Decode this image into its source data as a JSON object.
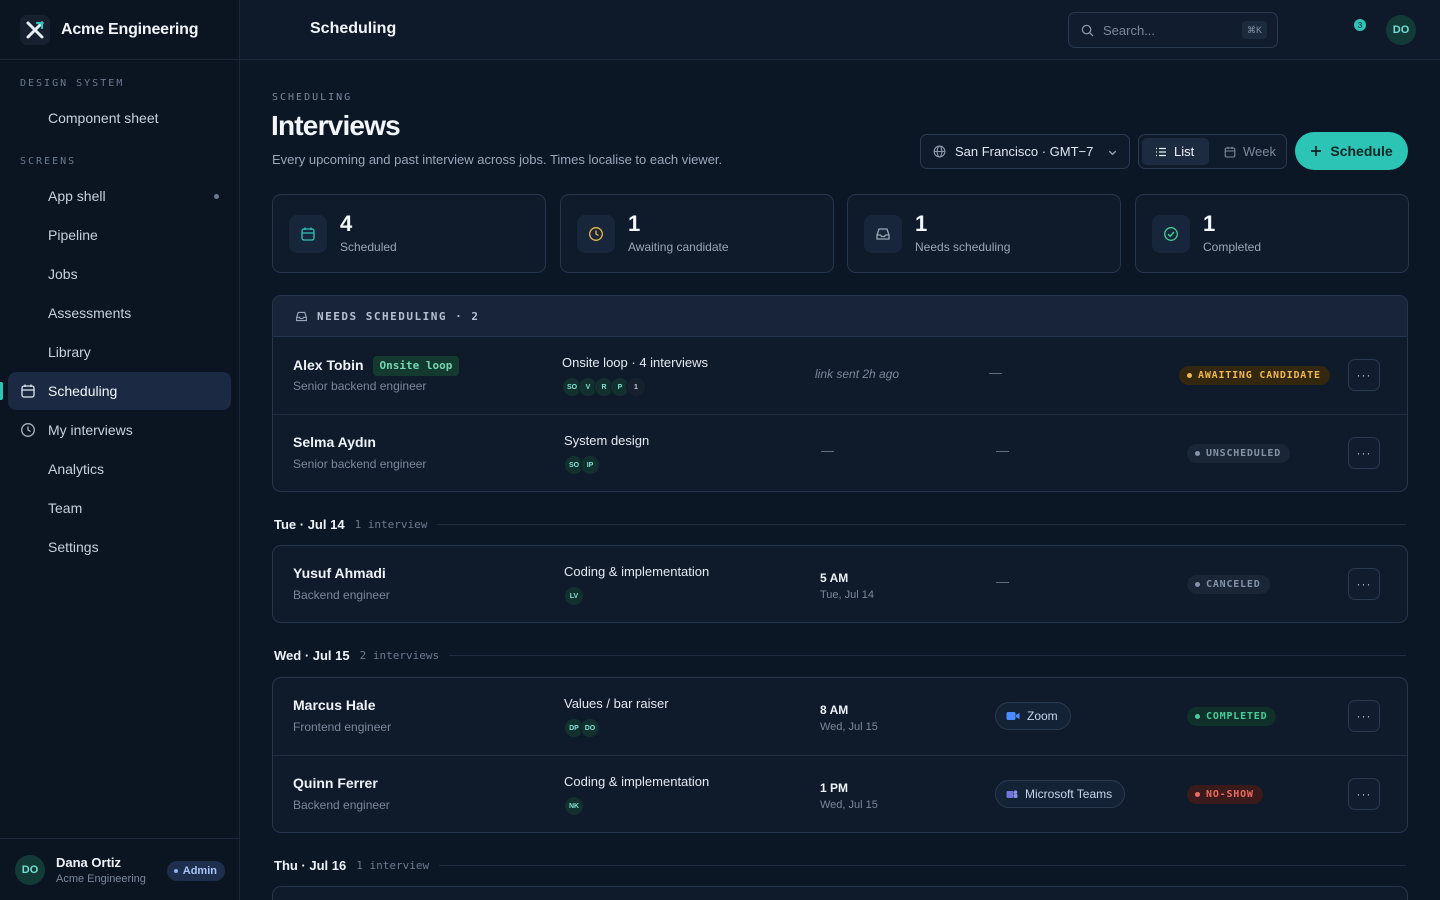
{
  "app": {
    "brand": "Acme Engineering"
  },
  "sidebar": {
    "section_design": "DESIGN SYSTEM",
    "section_screens": "SCREENS",
    "design_items": [
      {
        "label": "Component sheet"
      }
    ],
    "items": [
      {
        "label": "App shell"
      },
      {
        "label": "Pipeline"
      },
      {
        "label": "Jobs"
      },
      {
        "label": "Assessments"
      },
      {
        "label": "Library"
      },
      {
        "label": "Scheduling",
        "active": true
      },
      {
        "label": "My interviews"
      },
      {
        "label": "Analytics"
      },
      {
        "label": "Team"
      },
      {
        "label": "Settings"
      }
    ],
    "user": {
      "initials": "DO",
      "name": "Dana Ortiz",
      "org": "Acme Engineering",
      "role": "Admin"
    }
  },
  "topbar": {
    "title": "Scheduling",
    "search_placeholder": "Search...",
    "shortcut": "⌘K",
    "notification_count": "3",
    "avatar_initials": "DO"
  },
  "page": {
    "eyebrow": "SCHEDULING",
    "title": "Interviews",
    "subtitle": "Every upcoming and past interview across jobs. Times localise to each viewer.",
    "timezone": "San Francisco · GMT−7",
    "view_list": "List",
    "view_week": "Week",
    "schedule_label": "Schedule"
  },
  "stats": [
    {
      "value": "4",
      "label": "Scheduled",
      "icon": "calendar-icon",
      "color": "#2ec4b6"
    },
    {
      "value": "1",
      "label": "Awaiting candidate",
      "icon": "clock-icon",
      "color": "#f2b94a"
    },
    {
      "value": "1",
      "label": "Needs scheduling",
      "icon": "inbox-icon",
      "color": "#9aa7b8"
    },
    {
      "value": "1",
      "label": "Completed",
      "icon": "check-circle-icon",
      "color": "#45cf9a"
    }
  ],
  "needs_scheduling": {
    "header": "NEEDS SCHEDULING · 2",
    "rows": [
      {
        "name": "Alex Tobin",
        "tag": "Onsite loop",
        "role": "Senior backend engineer",
        "interview": "Onsite loop · 4 interviews",
        "chips": [
          "SO",
          "V",
          "R",
          "P",
          "1"
        ],
        "note": "link sent 2h ago",
        "meeting": "—",
        "status": "AWAITING CANDIDATE"
      },
      {
        "name": "Selma Aydın",
        "role": "Senior backend engineer",
        "interview": "System design",
        "chips": [
          "SO",
          "IP"
        ],
        "when": "—",
        "meeting": "—",
        "status": "UNSCHEDULED"
      }
    ]
  },
  "days": [
    {
      "label": "Tue · Jul 14",
      "count": "1 interview",
      "rows": [
        {
          "name": "Yusuf Ahmadi",
          "role": "Backend engineer",
          "interview": "Coding & implementation",
          "chips": [
            "LV"
          ],
          "time": "5 AM",
          "date": "Tue, Jul 14",
          "meeting": "—",
          "status": "CANCELED"
        }
      ]
    },
    {
      "label": "Wed · Jul 15",
      "count": "2 interviews",
      "rows": [
        {
          "name": "Marcus Hale",
          "role": "Frontend engineer",
          "interview": "Values / bar raiser",
          "chips": [
            "DP",
            "DO"
          ],
          "time": "8 AM",
          "date": "Wed, Jul 15",
          "meeting": "Zoom",
          "status": "COMPLETED"
        },
        {
          "name": "Quinn Ferrer",
          "role": "Backend engineer",
          "interview": "Coding & implementation",
          "chips": [
            "NK"
          ],
          "time": "1 PM",
          "date": "Wed, Jul 15",
          "meeting": "Microsoft Teams",
          "status": "NO-SHOW"
        }
      ]
    },
    {
      "label": "Thu · Jul 16",
      "count": "1 interview"
    }
  ],
  "more_label": "···"
}
